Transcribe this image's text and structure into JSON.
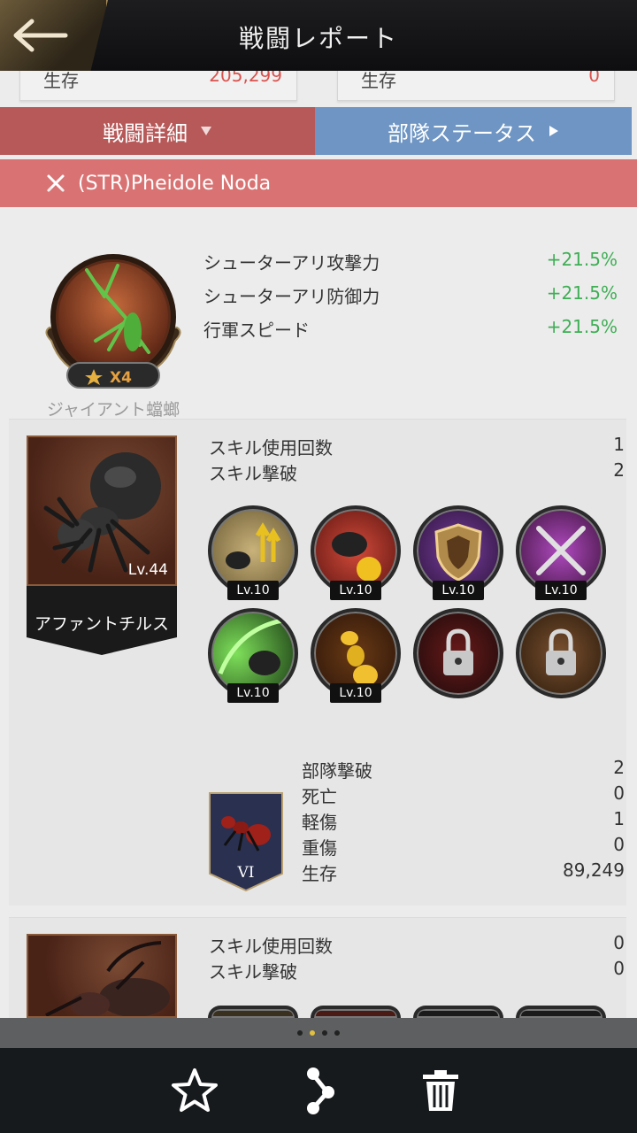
{
  "header": {
    "title": "戦闘レポート",
    "back_icon": "back-arrow-icon"
  },
  "survivors": {
    "left": {
      "label": "生存",
      "value": "205,299"
    },
    "right": {
      "label": "生存",
      "value": "0"
    }
  },
  "tabs": {
    "battle_detail": "戦闘詳細",
    "troop_status": "部隊ステータス"
  },
  "player": {
    "name": "(STR)Pheidole Noda",
    "icon": "crossed-swords-icon"
  },
  "hero": {
    "name": "ジャイアント蟷螂",
    "stars": "X4",
    "buffs": [
      {
        "label": "シューターアリ攻撃力",
        "value": "+21.5%"
      },
      {
        "label": "シューターアリ防御力",
        "value": "+21.5%"
      },
      {
        "label": "行軍スピード",
        "value": "+21.5%"
      }
    ]
  },
  "unit1": {
    "name": "アファントチルス",
    "level": "Lv.44",
    "stats": [
      {
        "label": "スキル使用回数",
        "value": "1"
      },
      {
        "label": "スキル撃破",
        "value": "2"
      }
    ],
    "skills": [
      {
        "level": "Lv.10",
        "icon": "ant-attack-up-skill-icon"
      },
      {
        "level": "Lv.10",
        "icon": "ant-honeypot-skill-icon"
      },
      {
        "level": "Lv.10",
        "icon": "shield-skill-icon"
      },
      {
        "level": "Lv.10",
        "icon": "crossed-swords-skill-icon"
      },
      {
        "level": "Lv.10",
        "icon": "green-slash-skill-icon"
      },
      {
        "level": "Lv.10",
        "icon": "golden-ant-skill-icon"
      },
      {
        "level": "",
        "icon": "locked-skill-icon"
      },
      {
        "level": "",
        "icon": "locked-skill-icon"
      }
    ],
    "troop": {
      "tier": "VI",
      "stats": [
        {
          "label": "部隊撃破",
          "value": "2"
        },
        {
          "label": "死亡",
          "value": "0"
        },
        {
          "label": "軽傷",
          "value": "1"
        },
        {
          "label": "重傷",
          "value": "0"
        },
        {
          "label": "生存",
          "value": "89,249"
        }
      ]
    }
  },
  "unit2": {
    "stats": [
      {
        "label": "スキル使用回数",
        "value": "0"
      },
      {
        "label": "スキル撃破",
        "value": "0"
      }
    ]
  },
  "pager": {
    "pages": 4,
    "active": 1
  },
  "toolbar": {
    "favorite_icon": "star-icon",
    "share_icon": "share-icon",
    "delete_icon": "trash-icon"
  },
  "colors": {
    "buff_green": "#3fae55",
    "loss_red": "#d9534f",
    "tab_red": "#b75959",
    "tab_blue": "#6e95c3",
    "player_bar": "#d97373"
  }
}
